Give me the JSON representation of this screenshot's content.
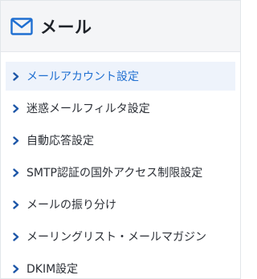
{
  "panel": {
    "title": "メール",
    "icon": "mail-icon"
  },
  "menu": {
    "items": [
      {
        "label": "メールアカウント設定",
        "active": true
      },
      {
        "label": "迷惑メールフィルタ設定",
        "active": false
      },
      {
        "label": "自動応答設定",
        "active": false
      },
      {
        "label": "SMTP認証の国外アクセス制限設定",
        "active": false
      },
      {
        "label": "メールの振り分け",
        "active": false
      },
      {
        "label": "メーリングリスト・メールマガジン",
        "active": false
      },
      {
        "label": "DKIM設定",
        "active": false
      }
    ]
  },
  "colors": {
    "accent": "#1f6fd1",
    "chevron": "#1e57a8",
    "header_bg": "#f4f5f7",
    "active_bg": "#eef3fb"
  }
}
